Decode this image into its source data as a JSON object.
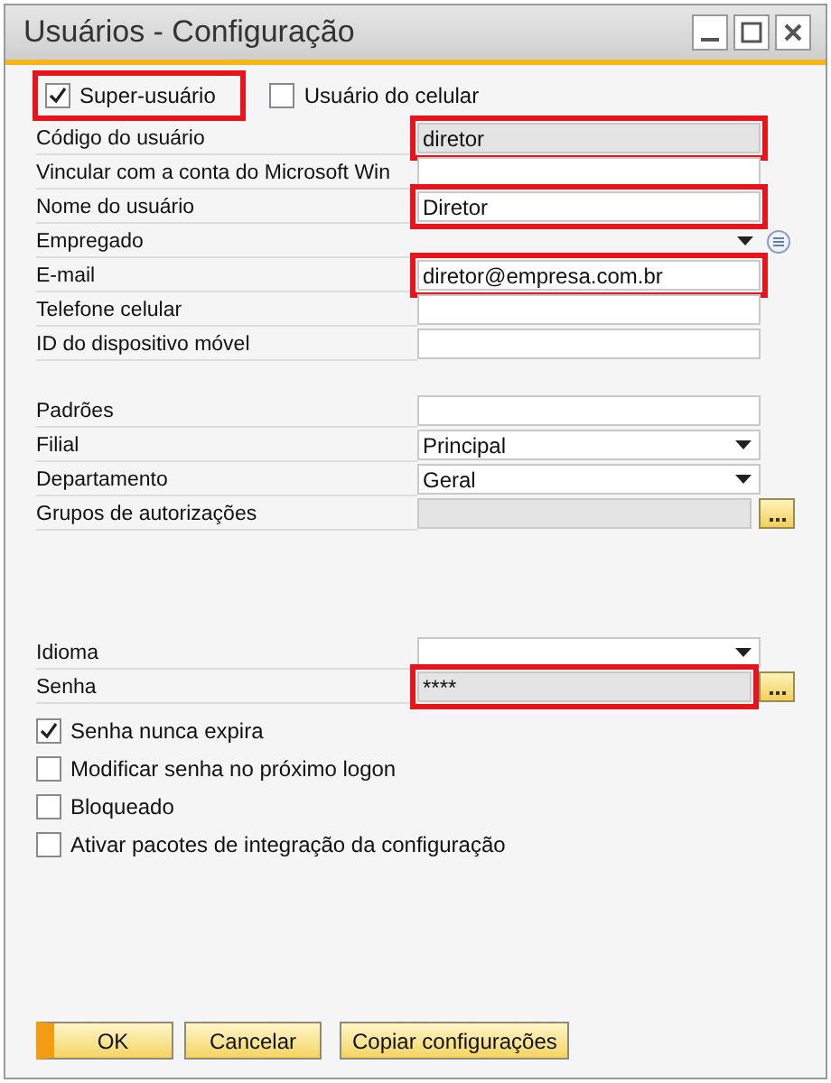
{
  "window": {
    "title": "Usuários - Configuração"
  },
  "top_checkboxes": [
    {
      "label": "Super-usuário",
      "checked": true,
      "highlighted": true
    },
    {
      "label": "Usuário do celular",
      "checked": false,
      "highlighted": false
    }
  ],
  "field_groups": [
    [
      {
        "label": "Código do usuário",
        "kind": "readonly",
        "value": "diretor",
        "highlighted": true
      },
      {
        "label": "Vincular com a conta do Microsoft Win",
        "kind": "text",
        "highlighted": false
      },
      {
        "label": "Nome do usuário",
        "kind": "text",
        "value": "Diretor",
        "highlighted": true
      },
      {
        "label": "Empregado",
        "kind": "lookup",
        "highlighted": false
      },
      {
        "label": "E-mail",
        "kind": "text",
        "value": "diretor@empresa.com.br",
        "highlighted": true
      },
      {
        "label": "Telefone celular",
        "kind": "text",
        "highlighted": false
      },
      {
        "label": "ID do dispositivo móvel",
        "kind": "text",
        "highlighted": false
      }
    ],
    [
      {
        "label": "Padrões",
        "kind": "text",
        "highlighted": false
      },
      {
        "label": "Filial",
        "kind": "dropdown",
        "value": "Principal",
        "highlighted": false
      },
      {
        "label": "Departamento",
        "kind": "dropdown",
        "value": "Geral",
        "highlighted": false
      },
      {
        "label": "Grupos de autorizações",
        "kind": "readonly",
        "browse": true,
        "highlighted": false
      }
    ],
    [
      {
        "label": "Idioma",
        "kind": "dropdown",
        "highlighted": false
      },
      {
        "label": "Senha",
        "kind": "readonly",
        "value": "****",
        "browse": true,
        "highlighted": true
      }
    ]
  ],
  "options": [
    {
      "label": "Senha nunca expira",
      "checked": true
    },
    {
      "label": "Modificar senha no próximo logon",
      "checked": false
    },
    {
      "label": "Bloqueado",
      "checked": false
    },
    {
      "label": "Ativar pacotes de integração da configuração",
      "checked": false
    }
  ],
  "buttons": [
    {
      "label": "OK",
      "kind": "default"
    },
    {
      "label": "Cancelar",
      "kind": "normal"
    },
    {
      "label": "Copiar configurações",
      "kind": "normal"
    }
  ]
}
